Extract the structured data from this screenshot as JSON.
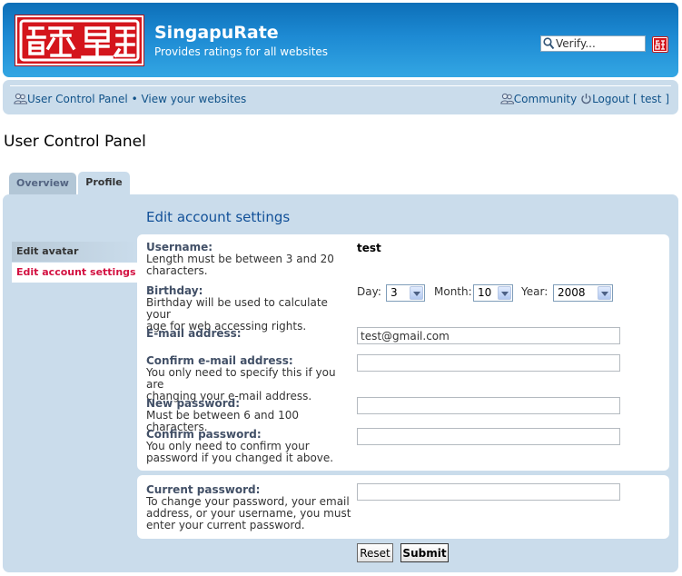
{
  "header": {
    "site_title": "SingapuRate",
    "site_description": "Provides ratings for all websites",
    "search_value": "Verify...",
    "logo_icon": "red-seal-logo",
    "verify_icon": "red-seal-small-icon"
  },
  "nav": {
    "ucp_label": "User Control Panel",
    "separator": "•",
    "websites_label": "View your websites",
    "community_label": "Community",
    "logout_label": "Logout [ test ]"
  },
  "page_title": "User Control Panel",
  "tabs": [
    {
      "label": "Overview",
      "active": false
    },
    {
      "label": "Profile",
      "active": true
    }
  ],
  "sidebar": {
    "items": [
      {
        "label": "Edit avatar",
        "active": false
      },
      {
        "label": "Edit account settings",
        "active": true
      }
    ]
  },
  "section_heading": "Edit account settings",
  "form": {
    "username": {
      "label": "Username:",
      "help_1": "Length must be between 3 and 20",
      "help_2": "characters.",
      "value": "test"
    },
    "birthday": {
      "label": "Birthday:",
      "help_1": "Birthday will be used to calculate your",
      "help_2": "age for web accessing rights.",
      "day_label": "Day:",
      "day_value": "3",
      "month_label": "Month:",
      "month_value": "10",
      "year_label": "Year:",
      "year_value": "2008"
    },
    "email": {
      "label": "E-mail address:",
      "value": "test@gmail.com"
    },
    "confirm_email": {
      "label": "Confirm e-mail address:",
      "help_1": "You only need to specify this if you are",
      "help_2": "changing your e-mail address.",
      "value": ""
    },
    "new_password": {
      "label": "New password:",
      "help_1": "Must be between 6 and 100 characters.",
      "value": ""
    },
    "confirm_password": {
      "label": "Confirm password:",
      "help_1": "You only need to confirm your",
      "help_2": "password if you changed it above.",
      "value": ""
    },
    "current_password": {
      "label": "Current password:",
      "help_1": "To change your password, your email",
      "help_2": "address, or your username, you must",
      "help_3": "enter your current password.",
      "value": ""
    }
  },
  "buttons": {
    "reset_label": "Reset",
    "submit_label": "Submit"
  },
  "colors": {
    "header_blue": "#1d8ad3",
    "panel_bg": "#cadceb",
    "accent_red": "#d31141",
    "link_blue": "#105289"
  }
}
